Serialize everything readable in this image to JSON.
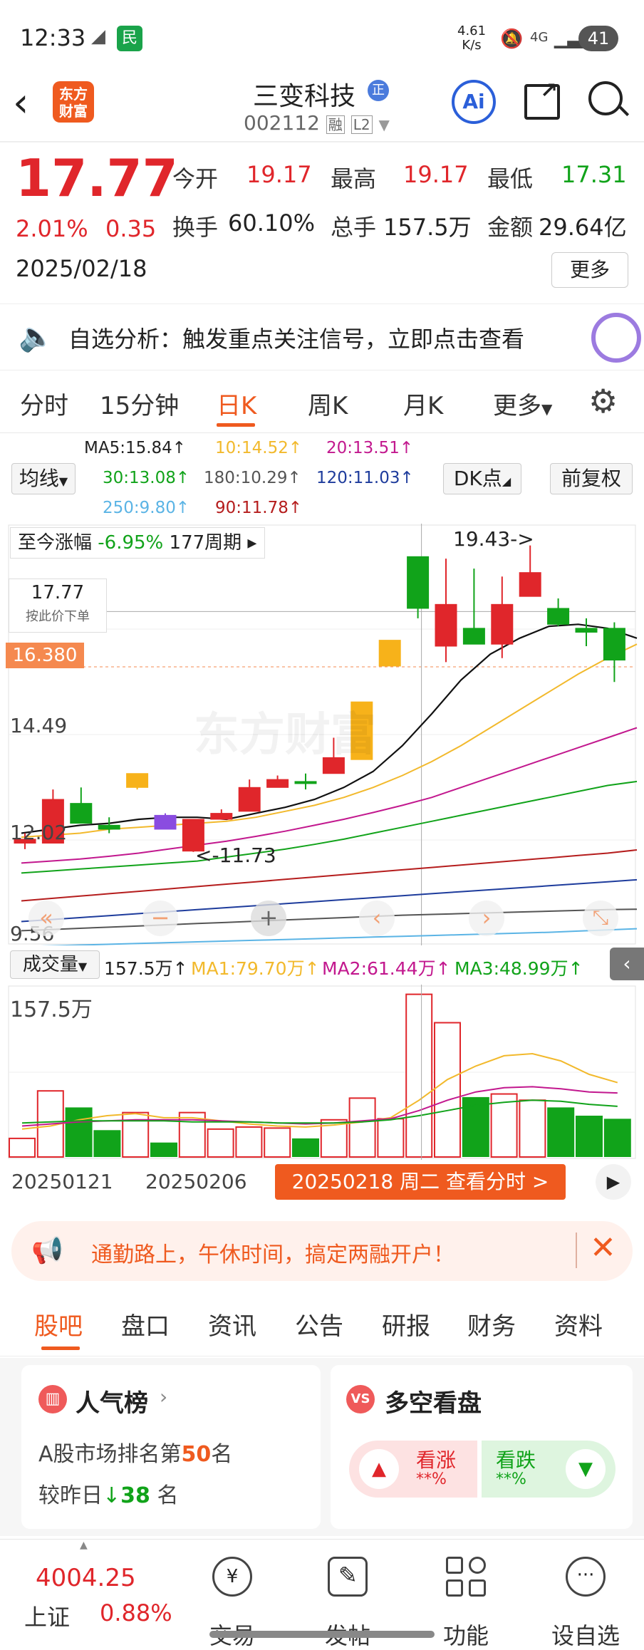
{
  "status_bar": {
    "time": "12:33",
    "speed": "4.61",
    "speed_unit": "K/s",
    "network": "4G",
    "battery": "41"
  },
  "header": {
    "stock_name": "三变科技",
    "badge": "正",
    "code": "002112",
    "tag1": "融",
    "tag2": "L2",
    "logo_text": "东方财富",
    "ai_label": "Ai"
  },
  "quote": {
    "price": "17.77",
    "change_pct": "2.01%",
    "change": "0.35",
    "date": "2025/02/18",
    "open_label": "今开",
    "open": "19.17",
    "high_label": "最高",
    "high": "19.17",
    "low_label": "最低",
    "low": "17.31",
    "turnover_label": "换手",
    "turnover": "60.10%",
    "volume_label": "总手",
    "volume": "157.5万",
    "amount_label": "金额",
    "amount": "29.64亿",
    "more_button": "更多"
  },
  "notice": {
    "text": "自选分析：触发重点关注信号，立即点击查看"
  },
  "tabs": [
    "分时",
    "15分钟",
    "日K",
    "周K",
    "月K",
    "更多"
  ],
  "active_tab": "日K",
  "ma": {
    "selector": "均线",
    "ma5": "MA5:15.84↑",
    "ma10": "10:14.52↑",
    "ma20": "20:13.51↑",
    "ma30": "30:13.08↑",
    "ma180": "180:10.29↑",
    "ma120": "120:11.03↑",
    "ma250": "250:9.80↑",
    "ma90": "90:11.78↑",
    "dk": "DK点",
    "restore": "前复权"
  },
  "chart_overlay": {
    "period_label": "至今涨幅",
    "period_pct": "-6.95%",
    "period_cycles": "177周期",
    "price_tag": "17.77",
    "price_tag_sub": "按此价下单",
    "current_line": "16.380",
    "y_labels": [
      "14.49",
      "12.02",
      "9.56"
    ],
    "high_mark": "19.43->",
    "low_mark": "<-11.73",
    "watermark": "东方财富"
  },
  "volume_bar": {
    "selector": "成交量",
    "vol": "157.5万↑",
    "ma1": "MA1:79.70万↑",
    "ma2": "MA2:61.44万↑",
    "ma3": "MA3:48.99万↑",
    "max_label": "157.5万"
  },
  "dates": {
    "d1": "20250121",
    "d2": "20250206",
    "current": "20250218 周二 查看分时 >"
  },
  "banner": {
    "text": "通勤路上，午休时间，搞定两融开户！"
  },
  "sections": [
    "股吧",
    "盘口",
    "资讯",
    "公告",
    "研报",
    "财务",
    "资料"
  ],
  "active_section": "股吧",
  "popular": {
    "title": "人气榜",
    "rank_prefix": "A股市场排名第",
    "rank": "50",
    "rank_suffix": "名",
    "change_prefix": "较昨日",
    "change": "38",
    "change_suffix": "名"
  },
  "bullbear": {
    "title": "多空看盘",
    "up_label": "看涨",
    "up_val": "**%",
    "down_label": "看跌",
    "down_val": "**%"
  },
  "bottom_nav": {
    "index_value": "4004.25",
    "index_name": "上证",
    "index_pct": "0.88%",
    "items": [
      "交易",
      "发帖",
      "功能",
      "设自选"
    ]
  },
  "colors": {
    "up": "#e0262b",
    "down": "#11a31a",
    "accent": "#ef5a1f",
    "ai_blue": "#2b5fd9"
  },
  "chart_data": {
    "type": "candlestick",
    "candles": [
      {
        "o": 12.05,
        "c": 11.95,
        "h": 12.2,
        "l": 11.8
      },
      {
        "o": 11.95,
        "c": 13.05,
        "h": 13.3,
        "l": 11.95
      },
      {
        "o": 12.95,
        "c": 12.45,
        "h": 13.35,
        "l": 12.45
      },
      {
        "o": 12.4,
        "c": 12.3,
        "h": 12.6,
        "l": 12.2
      },
      {
        "o": 13.35,
        "c": 13.7,
        "h": 13.7,
        "l": 13.3
      },
      {
        "o": 12.65,
        "c": 12.3,
        "h": 12.7,
        "l": 12.3
      },
      {
        "o": 12.55,
        "c": 11.75,
        "h": 12.55,
        "l": 11.73
      },
      {
        "o": 12.55,
        "c": 12.7,
        "h": 12.8,
        "l": 12.55
      },
      {
        "o": 12.75,
        "c": 13.35,
        "h": 13.55,
        "l": 12.75
      },
      {
        "o": 13.35,
        "c": 13.55,
        "h": 13.65,
        "l": 13.35
      },
      {
        "o": 13.5,
        "c": 13.5,
        "h": 13.7,
        "l": 13.3
      },
      {
        "o": 13.7,
        "c": 14.1,
        "h": 14.6,
        "l": 13.7
      },
      {
        "o": 14.05,
        "c": 15.5,
        "h": 15.5,
        "l": 14.05
      },
      {
        "o": 16.4,
        "c": 17.05,
        "h": 17.05,
        "l": 16.4
      },
      {
        "o": 19.15,
        "c": 17.85,
        "h": 19.15,
        "l": 17.6
      },
      {
        "o": 17.95,
        "c": 16.9,
        "h": 19.1,
        "l": 16.5
      },
      {
        "o": 16.95,
        "c": 17.35,
        "h": 18.85,
        "l": 16.95
      },
      {
        "o": 17.95,
        "c": 16.95,
        "h": 18.65,
        "l": 16.6
      },
      {
        "o": 18.15,
        "c": 18.75,
        "h": 19.43,
        "l": 18.15
      },
      {
        "o": 17.85,
        "c": 17.45,
        "h": 18.1,
        "l": 17.4
      },
      {
        "o": 17.35,
        "c": 17.25,
        "h": 17.6,
        "l": 16.9
      },
      {
        "o": 17.35,
        "c": 16.55,
        "h": 17.5,
        "l": 16.0
      }
    ],
    "candle_colors": [
      "down",
      "down-fill",
      "up",
      "up",
      "yellow",
      "purple",
      "down-fill",
      "down-fill",
      "down-fill",
      "down-fill",
      "up",
      "down-fill",
      "yellow",
      "yellow",
      "up",
      "down-fill",
      "up",
      "down-fill",
      "down-fill",
      "up",
      "up",
      "up"
    ],
    "ylim": [
      9.56,
      19.8
    ],
    "ma5": [
      12.2,
      12.3,
      12.4,
      12.45,
      12.55,
      12.6,
      12.6,
      12.55,
      12.7,
      12.85,
      13.05,
      13.35,
      13.75,
      14.4,
      15.2,
      16.05,
      16.7,
      17.1,
      17.4,
      17.45,
      17.35,
      17.1
    ],
    "ma10": [
      12.1,
      12.15,
      12.2,
      12.3,
      12.35,
      12.4,
      12.45,
      12.5,
      12.6,
      12.75,
      12.9,
      13.1,
      13.35,
      13.65,
      14.0,
      14.4,
      14.85,
      15.3,
      15.75,
      16.2,
      16.6,
      16.95
    ],
    "ma20": [
      11.45,
      11.5,
      11.55,
      11.62,
      11.7,
      11.8,
      11.9,
      12.0,
      12.12,
      12.25,
      12.4,
      12.55,
      12.72,
      12.9,
      13.1,
      13.35,
      13.6,
      13.85,
      14.1,
      14.35,
      14.6,
      14.85
    ],
    "ma30": [
      11.2,
      11.25,
      11.3,
      11.35,
      11.4,
      11.45,
      11.5,
      11.6,
      11.7,
      11.8,
      11.92,
      12.05,
      12.2,
      12.35,
      12.5,
      12.65,
      12.8,
      12.95,
      13.1,
      13.25,
      13.4,
      13.5
    ],
    "ma90": [
      10.5,
      10.56,
      10.62,
      10.68,
      10.74,
      10.8,
      10.86,
      10.92,
      10.98,
      11.04,
      11.1,
      11.16,
      11.22,
      11.28,
      11.34,
      11.4,
      11.46,
      11.52,
      11.58,
      11.64,
      11.7,
      11.78
    ],
    "ma120": [
      9.98,
      10.03,
      10.08,
      10.13,
      10.18,
      10.23,
      10.28,
      10.33,
      10.38,
      10.43,
      10.48,
      10.53,
      10.58,
      10.63,
      10.68,
      10.73,
      10.78,
      10.83,
      10.88,
      10.93,
      10.98,
      11.03
    ],
    "ma180": [
      9.75,
      9.78,
      9.81,
      9.84,
      9.87,
      9.9,
      9.93,
      9.96,
      9.99,
      10.02,
      10.05,
      10.08,
      10.11,
      10.14,
      10.16,
      10.18,
      10.2,
      10.22,
      10.24,
      10.26,
      10.28,
      10.29
    ],
    "ma250": [
      9.35,
      9.37,
      9.39,
      9.41,
      9.43,
      9.45,
      9.47,
      9.49,
      9.51,
      9.53,
      9.55,
      9.57,
      9.59,
      9.61,
      9.63,
      9.65,
      9.67,
      9.69,
      9.71,
      9.74,
      9.77,
      9.8
    ],
    "volume": [
      18,
      64,
      48,
      26,
      43,
      14,
      43,
      27,
      29,
      28,
      18,
      36,
      57,
      37,
      157.5,
      130,
      58,
      61,
      55,
      48,
      40,
      37
    ],
    "volume_colors": [
      "up",
      "up",
      "down",
      "down",
      "up",
      "down",
      "up",
      "up",
      "up",
      "up",
      "down",
      "up",
      "up",
      "up",
      "up",
      "up",
      "down",
      "up",
      "up",
      "down",
      "down",
      "down"
    ],
    "vol_ma1": [
      27,
      30,
      36,
      40,
      42,
      38,
      38,
      35,
      32,
      30,
      29,
      31,
      34,
      38,
      55,
      75,
      88,
      98,
      100,
      93,
      80,
      72
    ],
    "vol_ma2": [
      30,
      32,
      34,
      35,
      36,
      36,
      36,
      35,
      34,
      33,
      32,
      33,
      35,
      37,
      45,
      55,
      63,
      67,
      68,
      66,
      63,
      62
    ],
    "vol_ma3": [
      33,
      34,
      35,
      35,
      35,
      35,
      34,
      34,
      34,
      33,
      33,
      33,
      34,
      36,
      40,
      45,
      50,
      53,
      55,
      54,
      51,
      49
    ],
    "vol_ylim": [
      0,
      160
    ]
  }
}
